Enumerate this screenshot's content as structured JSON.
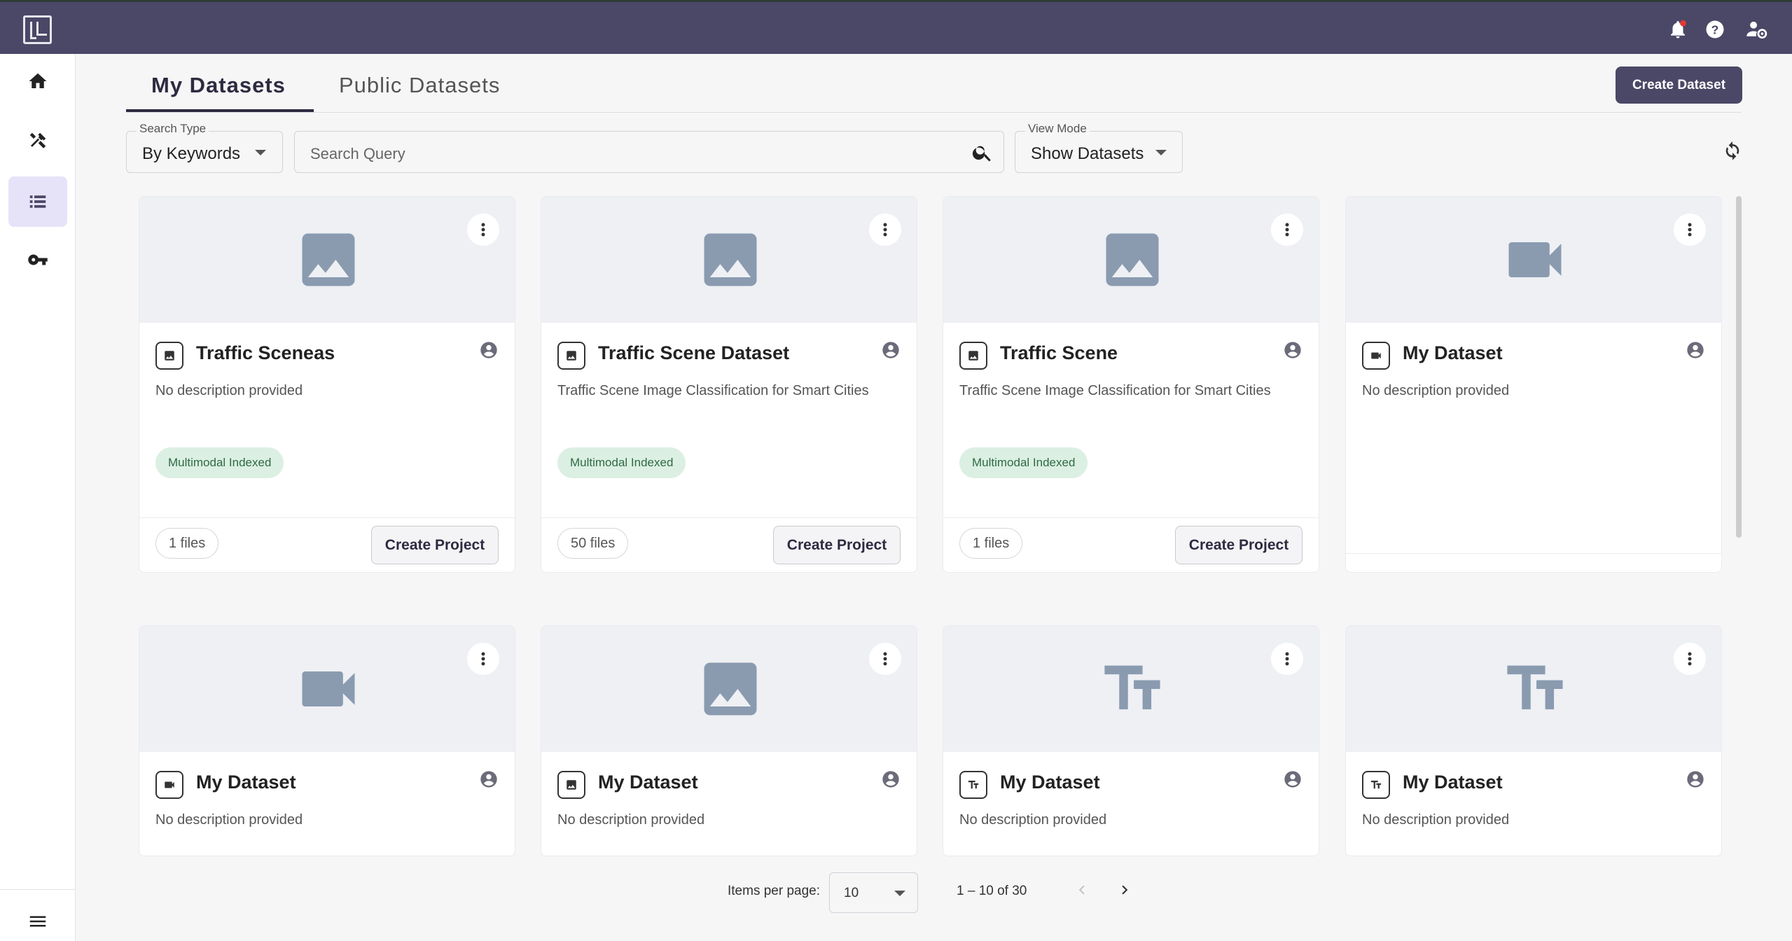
{
  "header": {
    "logo": "L-logo",
    "icons": [
      "bell-icon",
      "help-icon",
      "user-settings-icon"
    ],
    "notification_dot_color": "#e53935"
  },
  "sidebar": {
    "items": [
      {
        "name": "home",
        "icon": "home-icon"
      },
      {
        "name": "tools",
        "icon": "tools-icon"
      },
      {
        "name": "datasets",
        "icon": "list-icon",
        "active": true
      },
      {
        "name": "keys",
        "icon": "key-icon"
      }
    ],
    "bottom_icon": "menu-icon"
  },
  "tabs": [
    {
      "label": "My Datasets",
      "active": true
    },
    {
      "label": "Public Datasets",
      "active": false
    }
  ],
  "create_dataset_label": "Create Dataset",
  "filters": {
    "search_type_label": "Search Type",
    "search_type_value": "By Keywords",
    "search_placeholder": "Search Query",
    "view_mode_label": "View Mode",
    "view_mode_value": "Show Datasets"
  },
  "cards": [
    {
      "title": "Traffic Sceneas",
      "type": "image",
      "description": "No description provided",
      "chip": "Multimodal Indexed",
      "files": "1 files",
      "action": "Create Project"
    },
    {
      "title": "Traffic Scene Dataset",
      "type": "image",
      "description": "Traffic Scene Image Classification for Smart Cities",
      "chip": "Multimodal Indexed",
      "files": "50 files",
      "action": "Create Project"
    },
    {
      "title": "Traffic Scene",
      "type": "image",
      "description": "Traffic Scene Image Classification for Smart Cities",
      "chip": "Multimodal Indexed",
      "files": "1 files",
      "action": "Create Project"
    },
    {
      "title": "My Dataset",
      "type": "video",
      "description": "No description provided"
    },
    {
      "title": "My Dataset",
      "type": "video",
      "description": "No description provided"
    },
    {
      "title": "My Dataset",
      "type": "image",
      "description": "No description provided"
    },
    {
      "title": "My Dataset",
      "type": "text",
      "description": "No description provided"
    },
    {
      "title": "My Dataset",
      "type": "text",
      "description": "No description provided"
    }
  ],
  "pagination": {
    "items_per_page_label": "Items per page:",
    "items_per_page_value": "10",
    "range_label": "1 – 10 of 30"
  },
  "colors": {
    "brand": "#4b4766",
    "chip_bg": "#dcefe3",
    "chip_text": "#2e6b44",
    "icon_gray": "#8a9bb0"
  }
}
